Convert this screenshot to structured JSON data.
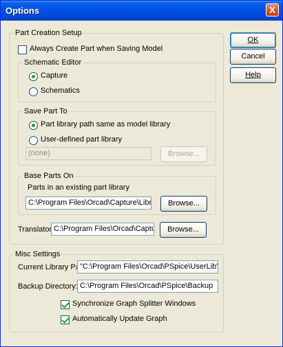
{
  "window": {
    "title": "Options",
    "close_glyph": "X"
  },
  "buttons": {
    "ok": "OK",
    "cancel": "Cancel",
    "help": "Help"
  },
  "part_creation": {
    "legend": "Part Creation Setup",
    "always_create": {
      "label": "Always Create Part when Saving Model",
      "checked": false
    },
    "schematic_editor": {
      "legend": "Schematic Editor",
      "options": [
        "Capture",
        "Schematics"
      ],
      "selected": "Capture"
    },
    "save_part_to": {
      "legend": "Save Part To",
      "options": [
        "Part library path same as model library",
        "User-defined part library"
      ],
      "selected": "Part library path same as model library",
      "user_path": "(none)",
      "browse": "Browse..."
    },
    "base_parts_on": {
      "legend": "Base Parts On",
      "label": "Parts in an existing part library",
      "path": "C:\\Program Files\\Orcad\\Capture\\Library\\",
      "browse": "Browse..."
    },
    "translator": {
      "label": "Translator:",
      "path": "C:\\Program Files\\Orcad\\Capture\\s",
      "browse": "Browse..."
    }
  },
  "misc": {
    "legend": "Misc Settings",
    "current_library_label": "Current Library Path:",
    "current_library_path": "\"C:\\Program Files\\Orcad\\PSpice\\UserLib\";\"C:",
    "backup_label": "Backup Directory:",
    "backup_path": "C:\\Program Files\\Orcad\\PSpice\\Backup",
    "sync_splitter": {
      "label": "Synchronize Graph Splitter Windows",
      "checked": true
    },
    "auto_update": {
      "label": "Automatically Update Graph",
      "checked": true
    }
  }
}
